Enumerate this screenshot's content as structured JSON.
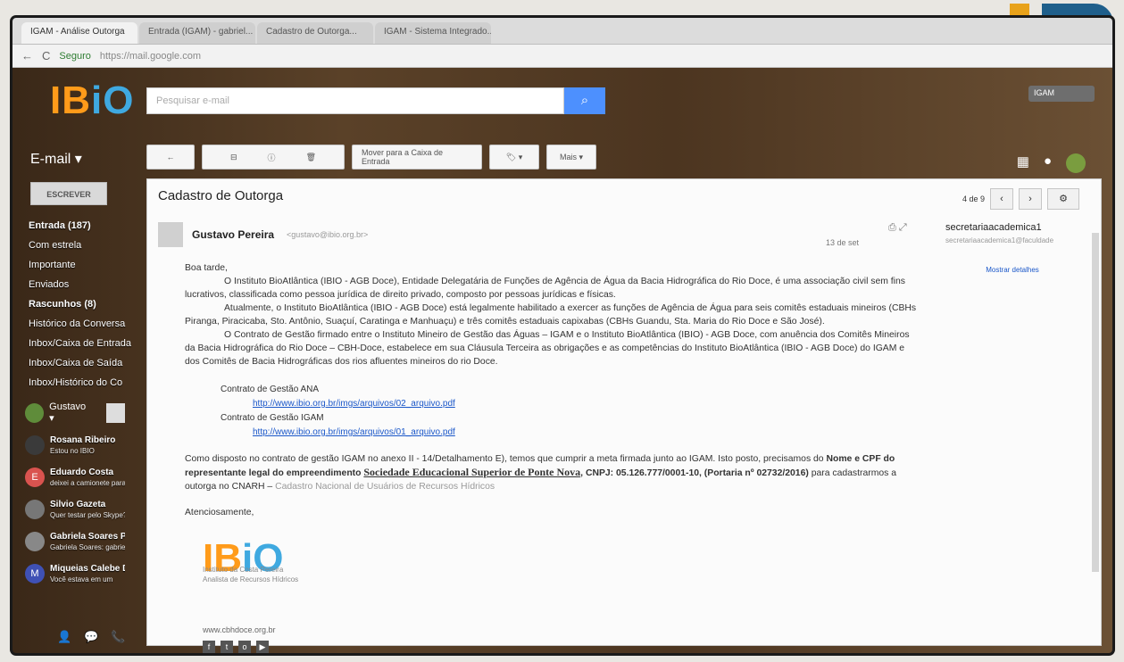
{
  "browser": {
    "tabs": [
      "IGAM - Análise Outorga",
      "Entrada (IGAM) - gabriel...",
      "Cadastro de Outorga...",
      "IGAM - Sistema Integrado..."
    ],
    "url_secure": "Seguro",
    "url": "https://mail.google.com"
  },
  "brand": {
    "prefix": "IB",
    "suffix": "iO"
  },
  "search": {
    "placeholder": "Pesquisar e-mail",
    "button_icon": "search-icon"
  },
  "topbar": {
    "account": "IGAM",
    "mail_label": "E-mail ▾"
  },
  "toolbar": {
    "back": "←",
    "archive": "⊟",
    "report": "ⓘ",
    "delete": "🗑",
    "move": "Mover para a Caixa de Entrada",
    "labels": "🏷 ▾",
    "more": "Mais ▾"
  },
  "sidebar": {
    "compose": "ESCREVER",
    "items": [
      {
        "label": "Entrada (187)",
        "bold": true
      },
      {
        "label": "Com estrela",
        "bold": false
      },
      {
        "label": "Importante",
        "bold": false
      },
      {
        "label": "Enviados",
        "bold": false
      },
      {
        "label": "Rascunhos (8)",
        "bold": true
      },
      {
        "label": "Histórico da Conversa",
        "bold": false
      },
      {
        "label": "Inbox/Caixa de Entrada",
        "bold": false
      },
      {
        "label": "Inbox/Caixa de Saída",
        "bold": false
      },
      {
        "label": "Inbox/Histórico do Co",
        "bold": false
      }
    ],
    "user": "Gustavo ▾",
    "contacts": [
      {
        "name": "Rosana Ribeiro",
        "status": "Estou no IBIO",
        "initial": "",
        "color": "#3a3a3a"
      },
      {
        "name": "Eduardo Costa",
        "status": "deixei a camionete para",
        "initial": "E",
        "color": "#d9534f"
      },
      {
        "name": "Silvio Gazeta",
        "status": "Quer testar pelo Skype?",
        "initial": "",
        "color": "#777"
      },
      {
        "name": "Gabriela Soares Peri",
        "status": "Gabriela Soares: gabriela",
        "initial": "",
        "color": "#888"
      },
      {
        "name": "Miqueias Calebe Dc",
        "status": "Você estava em um",
        "initial": "M",
        "color": "#3f51b5"
      }
    ]
  },
  "mail": {
    "subject": "Cadastro de Outorga",
    "pager": "4 de 9",
    "sender": "Gustavo Pereira",
    "sender_email": "<gustavo@ibio.org.br>",
    "date": "13 de set",
    "greeting": "Boa tarde,",
    "p1": "O Instituto BioAtlântica (IBIO - AGB Doce), Entidade Delegatária de Funções de Agência de Água da Bacia Hidrográfica do Rio Doce, é uma associação civil sem fins lucrativos, classificada como pessoa jurídica de direito privado, composto por pessoas jurídicas e físicas.",
    "p2": "Atualmente, o Instituto BioAtlântica (IBIO - AGB Doce) está legalmente habilitado a exercer as funções de Agência de Água para seis comitês estaduais mineiros (CBHs Piranga, Piracicaba, Sto. Antônio, Suaçuí, Caratinga e Manhuaçu) e três comitês estaduais capixabas (CBHs Guandu, Sta. Maria do Rio Doce e São José).",
    "p3": "O Contrato de Gestão firmado entre o Instituto Mineiro de Gestão das Águas – IGAM e o Instituto BioAtlântica (IBIO) - AGB Doce, com anuência dos Comitês Mineiros da Bacia Hidrográfica do Rio Doce – CBH-Doce, estabelece em sua Cláusula Terceira as obrigações e as competências do Instituto BioAtlântica (IBIO - AGB Doce) do IGAM e dos Comitês de Bacia Hidrográficas dos rios afluentes mineiros do rio Doce.",
    "contract1_label": "Contrato de Gestão ANA",
    "contract1_link": "http://www.ibio.org.br/imgs/arquivos/02_arquivo.pdf",
    "contract2_label": "Contrato de Gestão IGAM",
    "contract2_link": "http://www.ibio.org.br/imgs/arquivos/01_arquivo.pdf",
    "notice_a": "Como disposto no contrato de gestão IGAM no anexo II - 14/Detalhamento E), temos que cumprir a meta firmada junto ao IGAM. Isto posto, precisamos do ",
    "notice_b": "Nome e CPF do representante legal do empreendimento ",
    "company": "Sociedade Educacional Superior de Ponte Nova",
    "notice_c": ", CNPJ: 05.126.777/0001-10, (Portaria nº 02732/2016)",
    "notice_d": " para cadastrarmos a outorga no CNARH – ",
    "notice_e": "Cadastro Nacional de Usuários de Recursos Hídricos",
    "regards": "Atenciosamente,",
    "sig_name": "Instituto da Costa Pereira",
    "sig_role": "Analista de Recursos Hídricos",
    "sig_url": "www.cbhdoce.org.br"
  },
  "side_panel": {
    "name": "secretariaacademica1",
    "email": "secretariaacademica1@faculdade",
    "link": "Mostrar detalhes"
  }
}
